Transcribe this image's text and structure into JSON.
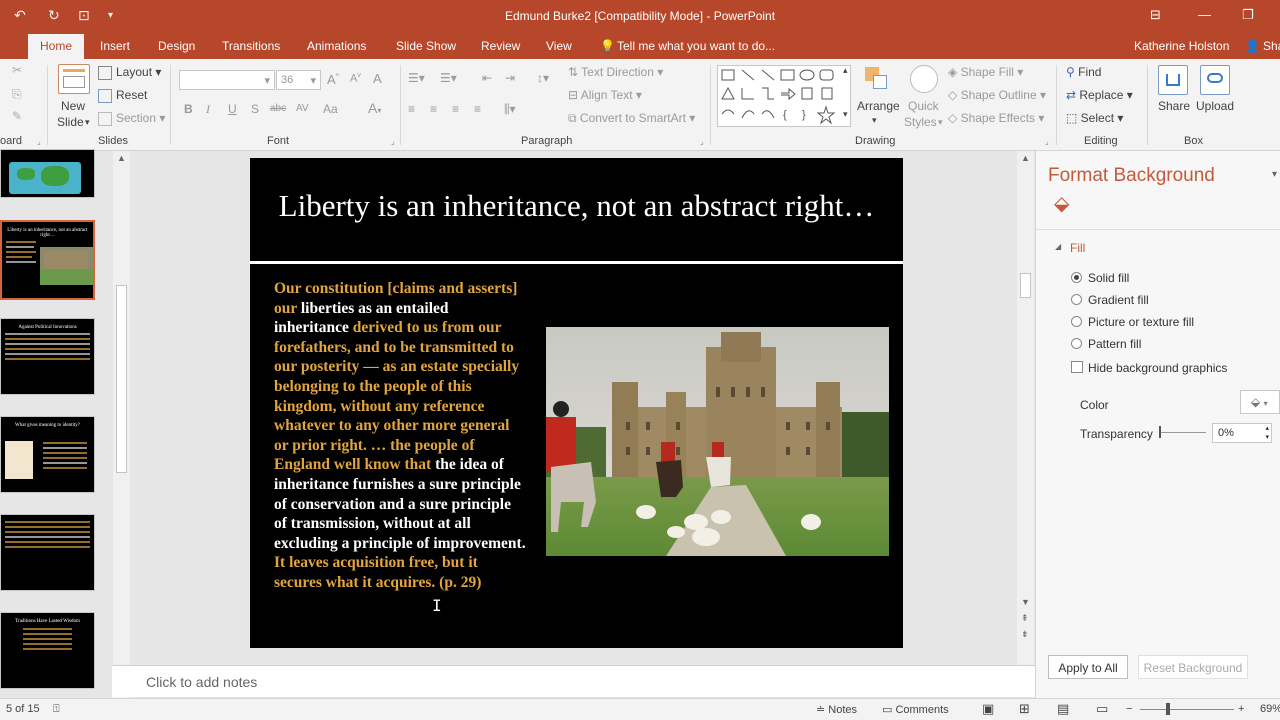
{
  "window": {
    "title": "Edmund Burke2 [Compatibility Mode] - PowerPoint"
  },
  "tabs": [
    "Home",
    "Insert",
    "Design",
    "Transitions",
    "Animations",
    "Slide Show",
    "Review",
    "View"
  ],
  "tell_me": "Tell me what you want to do...",
  "user": "Katherine Holston",
  "share_tab": "Sha",
  "ribbon": {
    "clipboard_label": "oard",
    "slides": {
      "new_slide_line1": "New",
      "new_slide_line2": "Slide",
      "layout": "Layout",
      "reset": "Reset",
      "section": "Section",
      "label": "Slides"
    },
    "font": {
      "size": "36",
      "bold": "B",
      "italic": "I",
      "underline": "U",
      "strike": "S",
      "shadow": "abc",
      "spacing": "AV",
      "case": "Aa",
      "label": "Font"
    },
    "paragraph": {
      "text_direction": "Text Direction",
      "align_text": "Align Text",
      "smartart": "Convert to SmartArt",
      "label": "Paragraph"
    },
    "drawing": {
      "arrange": "Arrange",
      "quick_styles_line1": "Quick",
      "quick_styles_line2": "Styles",
      "shape_fill": "Shape Fill",
      "shape_outline": "Shape Outline",
      "shape_effects": "Shape Effects",
      "label": "Drawing"
    },
    "editing": {
      "find": "Find",
      "replace": "Replace",
      "select": "Select",
      "label": "Editing"
    },
    "box": {
      "share": "Share",
      "upload": "Upload",
      "label": "Box"
    }
  },
  "slide": {
    "title": "Liberty is an inheritance, not an abstract right…",
    "body_segments": [
      {
        "text": "Our constitution [claims and asserts] our ",
        "style": "gold"
      },
      {
        "text": "liberties as an entailed inheritance ",
        "style": "white"
      },
      {
        "text": "derived to us from our forefathers, and to be transmitted to our posterity — as an estate specially belonging to the people of this kingdom, without any reference whatever to any other more general or prior right. … the people of England well know that ",
        "style": "gold"
      },
      {
        "text": "the idea of inheritance furnishes a sure principle of conservation and a sure principle of transmission, without at all excluding a principle of improvement. ",
        "style": "white"
      },
      {
        "text": "It leaves acquisition free, but it secures what it acquires. (p. 29)",
        "style": "gold"
      }
    ]
  },
  "thumbnails": [
    {
      "title": ""
    },
    {
      "title": "Liberty is an inheritance, not an abstract right…"
    },
    {
      "title": "Against Political Innovations"
    },
    {
      "title": "What gives meaning to identity?"
    },
    {
      "title": ""
    },
    {
      "title": "Traditions Have Lasted Wisdom"
    }
  ],
  "notes_placeholder": "Click to add notes",
  "format_pane": {
    "title": "Format Background",
    "section": "Fill",
    "options": [
      "Solid fill",
      "Gradient fill",
      "Picture or texture fill",
      "Pattern fill"
    ],
    "selected": "Solid fill",
    "hide_graphics": "Hide background graphics",
    "color_label": "Color",
    "transparency_label": "Transparency",
    "transparency_value": "0%",
    "apply_all": "Apply to All",
    "reset_bg": "Reset Background"
  },
  "status": {
    "slide_count": "5 of 15",
    "notes": "Notes",
    "comments": "Comments",
    "zoom": "69%"
  },
  "colors": {
    "accent": "#b7472a",
    "gold_text": "#e0a53f",
    "pane_title": "#c55a3a"
  }
}
